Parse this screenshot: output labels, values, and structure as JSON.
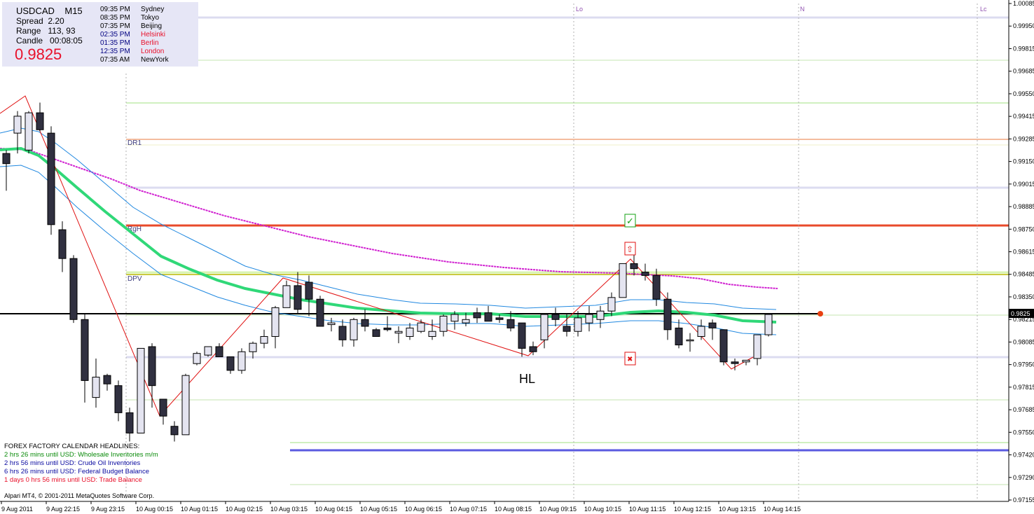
{
  "window": {
    "symbol": "USDCAD",
    "timeframe": "M15"
  },
  "info_panel": {
    "spread_label": "Spread",
    "spread_value": "2.20",
    "range_label": "Range",
    "range_value": "113, 93",
    "candle_label": "Candle",
    "candle_value": "00:08:05",
    "price": "0.9825",
    "sessions": [
      {
        "time": "09:35 PM",
        "city": "Sydney",
        "color": "#000000"
      },
      {
        "time": "08:35 PM",
        "city": "Tokyo",
        "color": "#000000"
      },
      {
        "time": "07:35 PM",
        "city": "Beijing",
        "color": "#000000"
      },
      {
        "time": "02:35 PM",
        "city": "Helsinki",
        "color": "#e8102a"
      },
      {
        "time": "01:35 PM",
        "city": "Berlin",
        "color": "#e8102a"
      },
      {
        "time": "12:35 PM",
        "city": "London",
        "color": "#e8102a"
      },
      {
        "time": "07:35 AM",
        "city": "NewYork",
        "color": "#000000"
      }
    ],
    "session_time_colors": [
      "#000000",
      "#000000",
      "#000000",
      "#000080",
      "#000080",
      "#000080",
      "#000000"
    ]
  },
  "news": {
    "header": "FOREX FACTORY CALENDAR HEADLINES:",
    "items": [
      {
        "text": "2 hrs 26 mins until USD: Wholesale Inventories m/m",
        "color": "#0a8a0a"
      },
      {
        "text": "2 hrs 56 mins until USD: Crude Oil Inventories",
        "color": "#0a0aa0"
      },
      {
        "text": "6 hrs 26 mins until USD: Federal Budget Balance",
        "color": "#0a0aa0"
      },
      {
        "text": "1 days 0 hrs 56 mins until USD: Trade Balance",
        "color": "#e8102a"
      }
    ]
  },
  "copyright": "Alpari MT4, © 2001-2011 MetaQuotes Software Corp.",
  "annotations": {
    "hl": "HL",
    "dr1": "DR1",
    "rgh": "RgH",
    "dpv": "DPV",
    "session_markers": [
      "Lo",
      "N",
      "Lc"
    ],
    "current_price_tag": "0.9825"
  },
  "chart_data": {
    "type": "candlestick",
    "symbol": "USDCAD",
    "timeframe": "M15",
    "price_axis": {
      "range": [
        0.97155,
        1.00085
      ],
      "ticks": [
        "1.00085",
        "0.99950",
        "0.99815",
        "0.99685",
        "0.99550",
        "0.99415",
        "0.99285",
        "0.99150",
        "0.99015",
        "0.98885",
        "0.98750",
        "0.98615",
        "0.98485",
        "0.98350",
        "0.98215",
        "0.98085",
        "0.97950",
        "0.97815",
        "0.97685",
        "0.97550",
        "0.97420",
        "0.97290",
        "0.97155"
      ]
    },
    "time_axis": {
      "ticks": [
        "9 Aug 2011",
        "9 Aug 22:15",
        "9 Aug 23:15",
        "10 Aug 00:15",
        "10 Aug 01:15",
        "10 Aug 02:15",
        "10 Aug 03:15",
        "10 Aug 04:15",
        "10 Aug 05:15",
        "10 Aug 06:15",
        "10 Aug 07:15",
        "10 Aug 08:15",
        "10 Aug 09:15",
        "10 Aug 10:15",
        "10 Aug 11:15",
        "10 Aug 12:15",
        "10 Aug 13:15",
        "10 Aug 14:15"
      ]
    },
    "candles": [
      [
        0.992,
        0.9922,
        0.9898,
        0.9914
      ],
      [
        0.9932,
        0.9945,
        0.992,
        0.9942
      ],
      [
        0.9922,
        0.9945,
        0.992,
        0.9944
      ],
      [
        0.9944,
        0.995,
        0.9933,
        0.9934
      ],
      [
        0.9932,
        0.9936,
        0.9872,
        0.9878
      ],
      [
        0.9875,
        0.988,
        0.985,
        0.9858
      ],
      [
        0.9858,
        0.986,
        0.982,
        0.9822
      ],
      [
        0.9822,
        0.9825,
        0.9773,
        0.9786
      ],
      [
        0.9776,
        0.9799,
        0.977,
        0.9788
      ],
      [
        0.9789,
        0.979,
        0.978,
        0.9784
      ],
      [
        0.9783,
        0.9786,
        0.9762,
        0.9767
      ],
      [
        0.9767,
        0.977,
        0.975,
        0.9755
      ],
      [
        0.9755,
        0.9805,
        0.9755,
        0.9805
      ],
      [
        0.9806,
        0.9808,
        0.977,
        0.9783
      ],
      [
        0.9775,
        0.9775,
        0.976,
        0.9765
      ],
      [
        0.9759,
        0.9762,
        0.975,
        0.9754
      ],
      [
        0.9754,
        0.979,
        0.9754,
        0.9789
      ],
      [
        0.9796,
        0.9803,
        0.9795,
        0.9802
      ],
      [
        0.9801,
        0.9806,
        0.98,
        0.9806
      ],
      [
        0.9806,
        0.9808,
        0.98,
        0.98
      ],
      [
        0.98,
        0.98,
        0.979,
        0.9792
      ],
      [
        0.9792,
        0.9805,
        0.979,
        0.9803
      ],
      [
        0.9803,
        0.9809,
        0.9799,
        0.9808
      ],
      [
        0.9808,
        0.9816,
        0.9805,
        0.9812
      ],
      [
        0.9812,
        0.983,
        0.9805,
        0.9829
      ],
      [
        0.9829,
        0.9845,
        0.9829,
        0.9842
      ],
      [
        0.9842,
        0.985,
        0.9825,
        0.9828
      ],
      [
        0.9844,
        0.9848,
        0.9824,
        0.9834
      ],
      [
        0.9834,
        0.9836,
        0.9818,
        0.9818
      ],
      [
        0.9819,
        0.9823,
        0.9815,
        0.982
      ],
      [
        0.9818,
        0.9822,
        0.9806,
        0.981
      ],
      [
        0.981,
        0.9823,
        0.9806,
        0.9822
      ],
      [
        0.9822,
        0.9828,
        0.9815,
        0.9818
      ],
      [
        0.9816,
        0.9817,
        0.9812,
        0.9812
      ],
      [
        0.9817,
        0.9824,
        0.9815,
        0.9816
      ],
      [
        0.9814,
        0.9818,
        0.9808,
        0.9815
      ],
      [
        0.9812,
        0.982,
        0.981,
        0.9817
      ],
      [
        0.9815,
        0.9822,
        0.9814,
        0.982
      ],
      [
        0.9812,
        0.9822,
        0.981,
        0.9815
      ],
      [
        0.9815,
        0.9825,
        0.9812,
        0.9824
      ],
      [
        0.9821,
        0.9827,
        0.9816,
        0.9825
      ],
      [
        0.982,
        0.9826,
        0.9818,
        0.9822
      ],
      [
        0.9826,
        0.9829,
        0.982,
        0.9823
      ],
      [
        0.9826,
        0.983,
        0.9822,
        0.9821
      ],
      [
        0.9823,
        0.9825,
        0.982,
        0.9822
      ],
      [
        0.9822,
        0.9827,
        0.9815,
        0.9817
      ],
      [
        0.982,
        0.982,
        0.98,
        0.9805
      ],
      [
        0.9806,
        0.9809,
        0.9801,
        0.9803
      ],
      [
        0.981,
        0.9825,
        0.9805,
        0.9825
      ],
      [
        0.9825,
        0.9829,
        0.9818,
        0.9822
      ],
      [
        0.9818,
        0.9825,
        0.9812,
        0.9815
      ],
      [
        0.9815,
        0.9827,
        0.9812,
        0.9823
      ],
      [
        0.982,
        0.983,
        0.9815,
        0.9825
      ],
      [
        0.9822,
        0.983,
        0.9817,
        0.9827
      ],
      [
        0.9827,
        0.9838,
        0.9824,
        0.9835
      ],
      [
        0.9835,
        0.9855,
        0.9835,
        0.9855
      ],
      [
        0.9855,
        0.986,
        0.9848,
        0.9852
      ],
      [
        0.985,
        0.9855,
        0.9845,
        0.9848
      ],
      [
        0.9848,
        0.9852,
        0.983,
        0.9834
      ],
      [
        0.9834,
        0.9838,
        0.981,
        0.9816
      ],
      [
        0.9817,
        0.9822,
        0.9805,
        0.9807
      ],
      [
        0.981,
        0.9814,
        0.9803,
        0.981
      ],
      [
        0.9812,
        0.9822,
        0.981,
        0.9818
      ],
      [
        0.982,
        0.9822,
        0.981,
        0.9817
      ],
      [
        0.9816,
        0.9816,
        0.9795,
        0.9797
      ],
      [
        0.9797,
        0.9799,
        0.9792,
        0.9796
      ],
      [
        0.9797,
        0.9798,
        0.9795,
        0.9798
      ],
      [
        0.9799,
        0.9813,
        0.9795,
        0.9813
      ],
      [
        0.9813,
        0.9825,
        0.9812,
        0.9825
      ]
    ],
    "horizontal_levels": [
      {
        "label": "DR1",
        "price": 0.99265,
        "color": "#e87a3c"
      },
      {
        "label": "RgH",
        "price": 0.98765,
        "color": "#e84a2a"
      },
      {
        "label": "DPV",
        "price": 0.98485,
        "color": "#c8c800"
      },
      {
        "label": "",
        "price": 0.98245,
        "color": "#000000"
      },
      {
        "label": "",
        "price": 0.97445,
        "color": "#5a5ae0"
      }
    ]
  }
}
